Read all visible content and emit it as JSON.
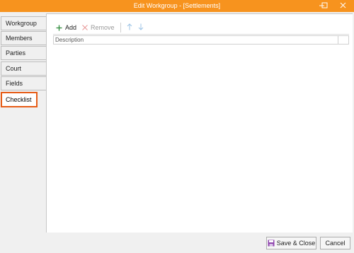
{
  "window": {
    "title": "Edit Workgroup - [Settlements]",
    "accent_color": "#f7931e",
    "controls": [
      "minimize-icon",
      "maximize-icon",
      "close-icon"
    ]
  },
  "tabs": [
    {
      "label": "Workgroup",
      "active": false
    },
    {
      "label": "Members",
      "active": false
    },
    {
      "label": "Parties",
      "active": false
    },
    {
      "label": "Court",
      "active": false
    },
    {
      "label": "Fields",
      "active": false
    },
    {
      "label": "Checklist",
      "active": true
    }
  ],
  "toolbar": {
    "add_label": "Add",
    "add_icon": "plus-icon",
    "remove_label": "Remove",
    "remove_icon": "x-icon",
    "move_up_icon": "arrow-up-icon",
    "move_down_icon": "arrow-down-icon"
  },
  "grid": {
    "columns": [
      "Description"
    ],
    "rows": []
  },
  "footer": {
    "save_label": "Save & Close",
    "save_icon": "floppy-disk-icon",
    "cancel_label": "Cancel"
  }
}
